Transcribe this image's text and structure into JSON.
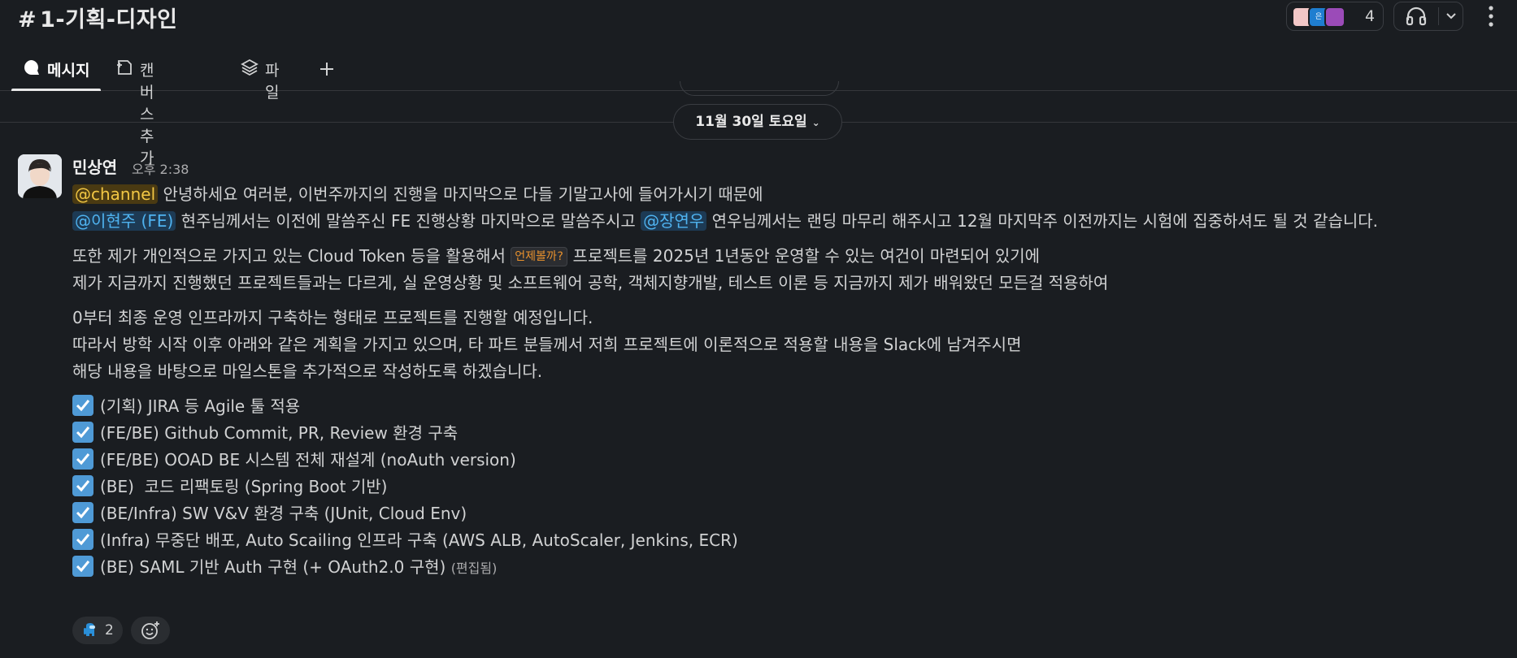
{
  "channel": {
    "hash": "#",
    "name": "1-기획-디자인"
  },
  "members": {
    "count": "4",
    "avatar2_text": "은"
  },
  "tabs": [
    {
      "label": "메시지"
    },
    {
      "label": "캔버스 추가"
    },
    {
      "label": "파일"
    }
  ],
  "date_divider": {
    "label": "11월 30일 토요일"
  },
  "message": {
    "sender": "민상연",
    "time": "오후 2:38",
    "line1_mention": "@channel",
    "line1_text": " 안녕하세요 여러분, 이번주까지의 진행을 마지막으로 다들 기말고사에 들어가시기 때문에",
    "line2_mention1": "@이현주 (FE)",
    "line2_text1": " 현주님께서는 이전에 말씀주신 FE 진행상황 마지막으로 말씀주시고 ",
    "line2_mention2": "@장연우",
    "line2_text2": " 연우님께서는 랜딩 마무리 해주시고 12월 마지막주 이전까지는 시험에 집중하셔도 될 것 같습니다.",
    "para2_text1": "또한 제가 개인적으로 가지고 있는 Cloud Token 등을 활용해서 ",
    "para2_code": "언제볼까?",
    "para2_text2": " 프로젝트를 2025년 1년동안 운영할 수 있는 여건이 마련되어 있기에",
    "para2_line2": "제가 지금까지 진행했던 프로젝트들과는 다르게, 실 운영상황 및 소프트웨어 공학, 객체지향개발, 테스트 이론 등 지금까지 제가 배워왔던 모든걸 적용하여",
    "para3_line1": "0부터 최종 운영 인프라까지 구축하는 형태로 프로젝트를 진행할 예정입니다.",
    "para3_line2": "따라서 방학 시작 이후 아래와 같은 계획을 가지고 있으며, 타 파트 분들께서 저희 프로젝트에 이론적으로 적용할 내용을 Slack에 남겨주시면",
    "para3_line3": "해당 내용을 바탕으로 마일스톤을 추가적으로 작성하도록 하겠습니다.",
    "checklist": [
      "(기획) JIRA 등 Agile 툴 적용",
      "(FE/BE) Github Commit, PR, Review 환경 구축",
      "(FE/BE) OOAD BE 시스템 전체 재설계 (noAuth version)",
      "(BE)  코드 리팩토링 (Spring Boot 기반)",
      "(BE/Infra) SW V&V 환경 구축 (JUnit, Cloud Env)",
      "(Infra) 무중단 배포, Auto Scailing 인프라 구축 (AWS ALB, AutoScaler, Jenkins, ECR)",
      "(BE) SAML 기반 Auth 구현 (+ OAuth2.0 구현)"
    ],
    "edited": "(편집됨)",
    "reaction_count": "2"
  },
  "icons": {
    "message_tab": "message-bubble-icon",
    "canvas_tab": "canvas-icon",
    "file_tab": "layers-icon",
    "add_tab": "plus-icon",
    "huddle": "headphones-icon",
    "chevron": "chevron-down-icon",
    "more": "kebab-icon",
    "check": "checkbox-checked-icon",
    "reaction": "among-us-icon",
    "add_reaction": "add-emoji-icon"
  },
  "colors": {
    "background": "#1a1d21",
    "channel_mention": "#f2c744",
    "user_mention": "#4fb3f0",
    "code_text": "#e8912d",
    "check_box": "#4f9ad6"
  }
}
